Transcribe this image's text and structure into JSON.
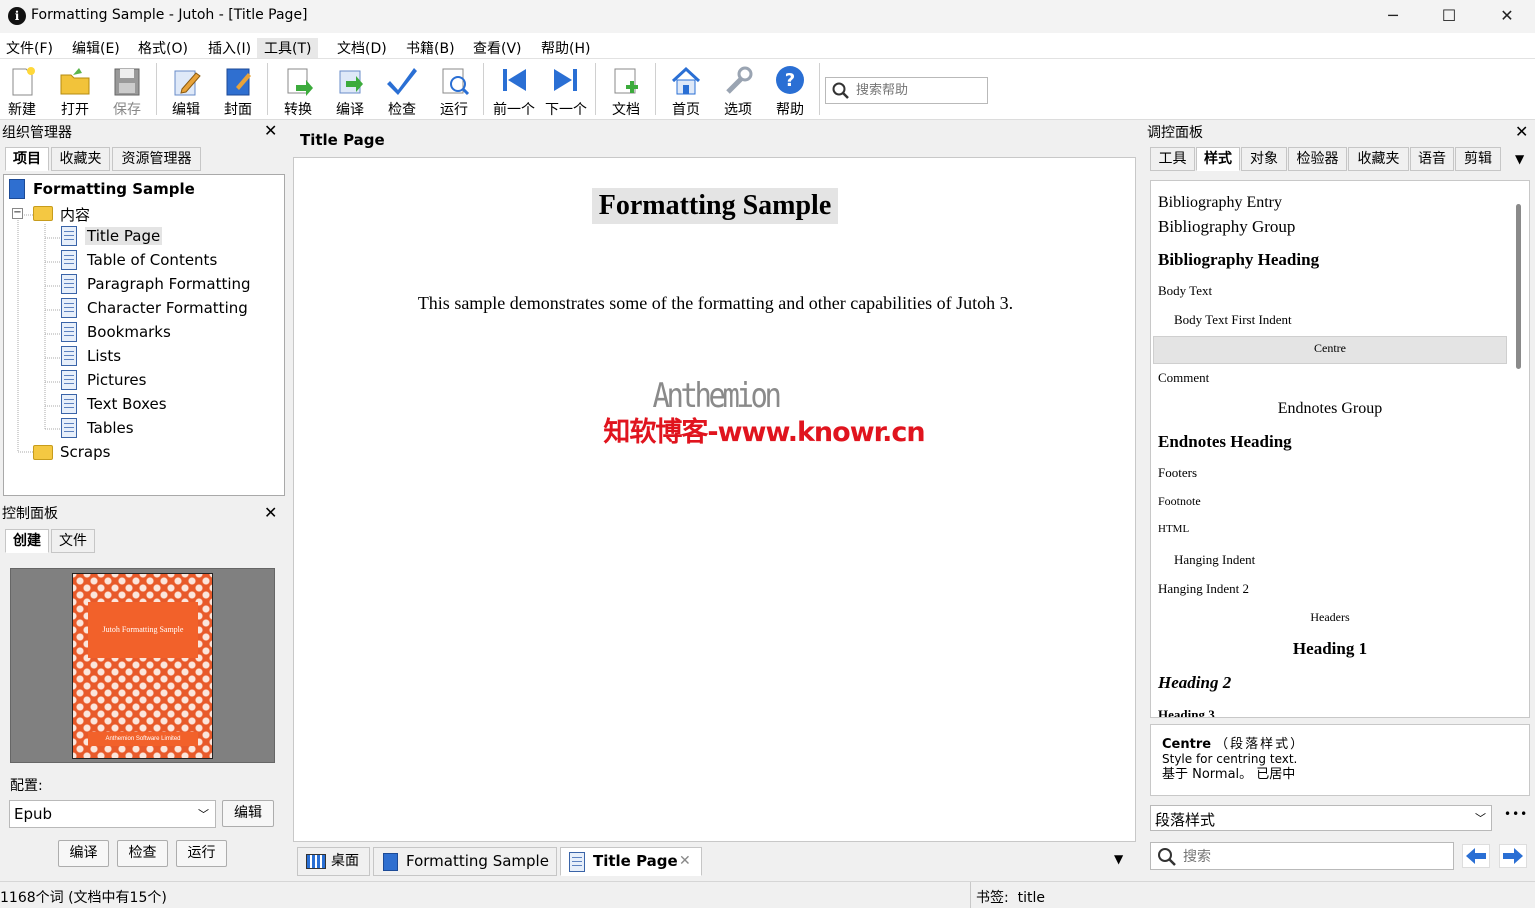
{
  "window": {
    "title": "Formatting Sample - Jutoh - [Title Page]",
    "min": "─",
    "max": "☐",
    "close": "✕"
  },
  "menu": [
    "文件(F)",
    "编辑(E)",
    "格式(O)",
    "插入(I)",
    "工具(T)",
    "文档(D)",
    "书籍(B)",
    "查看(V)",
    "帮助(H)"
  ],
  "toolbar": {
    "items": [
      "新建",
      "打开",
      "保存",
      "编辑",
      "封面",
      "转换",
      "编译",
      "检查",
      "运行",
      "前一个",
      "下一个",
      "文档",
      "首页",
      "选项",
      "帮助"
    ],
    "search_placeholder": "搜索帮助"
  },
  "organizer": {
    "title": "组织管理器",
    "tabs": [
      "项目",
      "收藏夹",
      "资源管理器"
    ],
    "project": "Formatting Sample",
    "folder": "内容",
    "items": [
      "Title Page",
      "Table of Contents",
      "Paragraph Formatting",
      "Character Formatting",
      "Bookmarks",
      "Lists",
      "Pictures",
      "Text Boxes",
      "Tables"
    ],
    "scraps": "Scraps"
  },
  "control": {
    "title": "控制面板",
    "tabs": [
      "创建",
      "文件"
    ],
    "cover_title": "Jutoh Formatting Sample",
    "cover_footer": "Anthemion Software Limited",
    "config_label": "配置:",
    "config_value": "Epub",
    "edit": "编辑",
    "compile": "编译",
    "check": "检查",
    "run": "运行"
  },
  "editor": {
    "title": "Title Page",
    "heading": "Formatting Sample",
    "body": "This sample demonstrates some of the formatting and other capabilities of Jutoh 3.",
    "logo": "Anthemion",
    "watermark": "知软博客-www.knowr.cn",
    "tabs": [
      "桌面",
      "Formatting Sample",
      "Title Page"
    ]
  },
  "inspector": {
    "title": "调控面板",
    "tabs": [
      "工具",
      "样式",
      "对象",
      "检验器",
      "收藏夹",
      "语音",
      "剪辑"
    ],
    "styles": [
      "Bibliography Entry",
      "Bibliography Group",
      "Bibliography Heading",
      "Body Text",
      "Body Text First Indent",
      "Centre",
      "Comment",
      "Endnotes Group",
      "Endnotes Heading",
      "Footers",
      "Footnote",
      "HTML",
      "Hanging Indent",
      "Hanging Indent 2",
      "Headers",
      "Heading 1",
      "Heading 2",
      "Heading 3"
    ],
    "desc_name": "Centre",
    "desc_kind": "（段落样式）",
    "desc_text": "Style for centring text.",
    "desc_base": "基于 Normal。 已居中",
    "style_type": "段落样式",
    "more": "•••",
    "search_placeholder": "搜索"
  },
  "status": {
    "words": "1168个词 (文档中有15个)",
    "bookmark": "书签:  title"
  }
}
